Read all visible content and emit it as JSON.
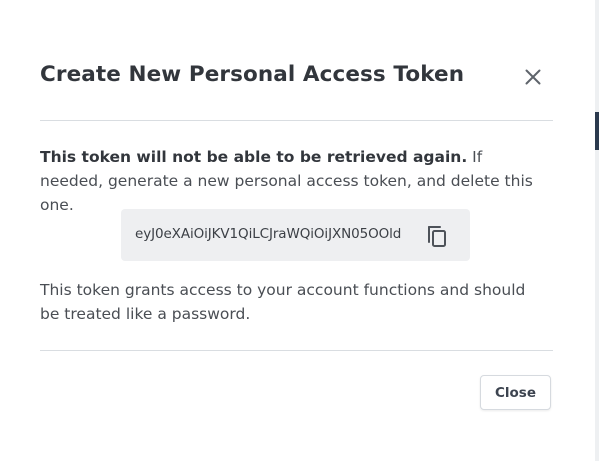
{
  "modal": {
    "title": "Create New Personal Access Token",
    "close_icon": "close-icon",
    "warning_bold": "This token will not be able to be retrieved again.",
    "warning_rest": " If needed, generate a new personal access token, and delete this one.",
    "token_value": "eyJ0eXAiOiJKV1QiLCJraWQiOiJXN05OOld",
    "copy_icon": "copy-icon",
    "grants_text": "This token grants access to your account functions and should be treated like a password.",
    "close_button_label": "Close"
  },
  "colors": {
    "title": "#32363c",
    "body_text": "#4a4e54",
    "token_box_bg": "#eeeff1",
    "divider": "#d9dde1",
    "edge_accent": "#2b3a4e"
  }
}
